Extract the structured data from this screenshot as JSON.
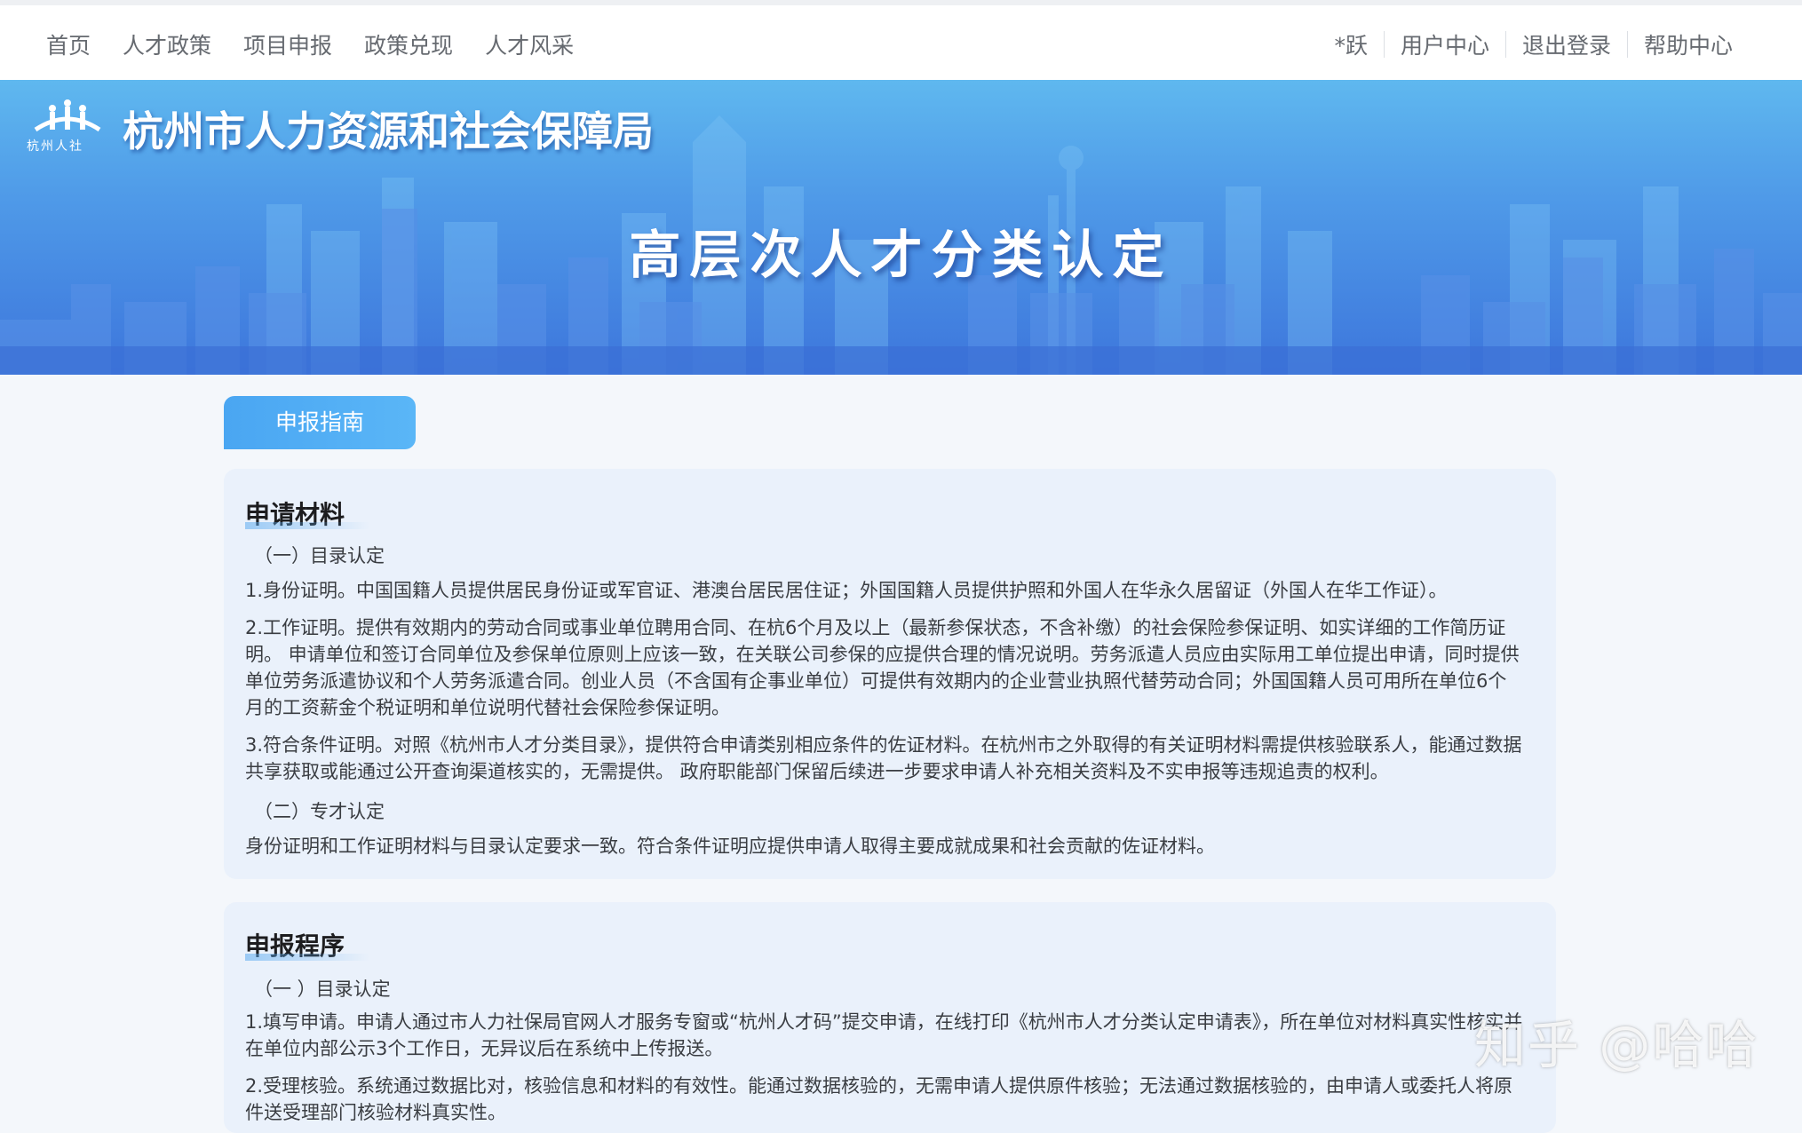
{
  "nav": {
    "left": [
      "首页",
      "人才政策",
      "项目申报",
      "政策兑现",
      "人才风采"
    ],
    "right": [
      "*跃",
      "用户中心",
      "退出登录",
      "帮助中心"
    ]
  },
  "banner": {
    "logo_text": "杭州人社",
    "bureau_name": "杭州市人力资源和社会保障局",
    "title": "高层次人才分类认定"
  },
  "tab": {
    "label": "申报指南"
  },
  "materials": {
    "title": "申请材料",
    "sub1": "（一）目录认定",
    "p1": "1.身份证明。中国国籍人员提供居民身份证或军官证、港澳台居民居住证；外国国籍人员提供护照和外国人在华永久居留证（外国人在华工作证）。",
    "p2": "2.工作证明。提供有效期内的劳动合同或事业单位聘用合同、在杭6个月及以上（最新参保状态，不含补缴）的社会保险参保证明、如实详细的工作简历证明。 申请单位和签订合同单位及参保单位原则上应该一致，在关联公司参保的应提供合理的情况说明。劳务派遣人员应由实际用工单位提出申请，同时提供单位劳务派遣协议和个人劳务派遣合同。创业人员（不含国有企事业单位）可提供有效期内的企业营业执照代替劳动合同；外国国籍人员可用所在单位6个月的工资薪金个税证明和单位说明代替社会保险参保证明。",
    "p3": "3.符合条件证明。对照《杭州市人才分类目录》，提供符合申请类别相应条件的佐证材料。在杭州市之外取得的有关证明材料需提供核验联系人，能通过数据共享获取或能通过公开查询渠道核实的，无需提供。 政府职能部门保留后续进一步要求申请人补充相关资料及不实申报等违规追责的权利。",
    "sub2": "（二）专才认定",
    "p4": "身份证明和工作证明材料与目录认定要求一致。符合条件证明应提供申请人取得主要成就成果和社会贡献的佐证材料。"
  },
  "procedure": {
    "title": "申报程序",
    "sub1": "（一 ）目录认定",
    "p1": "1.填写申请。申请人通过市人力社保局官网人才服务专窗或“杭州人才码”提交申请，在线打印《杭州市人才分类认定申请表》，所在单位对材料真实性核实并在单位内部公示3个工作日，无异议后在系统中上传报送。",
    "p2": "2.受理核验。系统通过数据比对，核验信息和材料的有效性。能通过数据核验的，无需申请人提供原件核验；无法通过数据核验的，由申请人或委托人将原件送受理部门核验材料真实性。"
  },
  "watermark": "知乎 @哈哈",
  "colors": {
    "accent": "#4aa6f2",
    "banner_top": "#5fb8ef",
    "banner_bottom": "#3d76dc"
  }
}
